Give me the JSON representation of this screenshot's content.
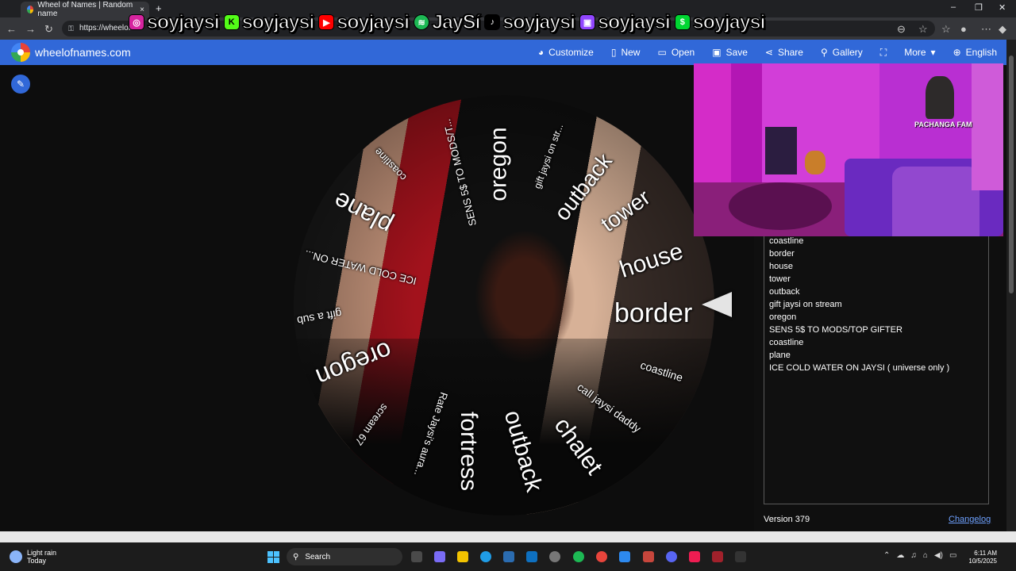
{
  "browser": {
    "tab_title": "Wheel of Names | Random name",
    "tab_close": "×",
    "new_tab": "+",
    "url": "https://wheelof",
    "win_min": "–",
    "win_max": "❐",
    "win_close": "✕"
  },
  "overlay": [
    {
      "platform": "instagram",
      "handle": "soyjaysi",
      "color": "#d6249f",
      "glyph": "◎"
    },
    {
      "platform": "kick",
      "handle": "soyjaysi",
      "color": "#53fc18",
      "glyph": "K"
    },
    {
      "platform": "youtube",
      "handle": "soyjaysi",
      "color": "#ff0000",
      "glyph": "▶"
    },
    {
      "platform": "spotify",
      "handle": "JaySí",
      "color": "#1db954",
      "glyph": "≋"
    },
    {
      "platform": "tiktok",
      "handle": "soyjaysi",
      "color": "#000000",
      "glyph": "♪"
    },
    {
      "platform": "twitch",
      "handle": "soyjaysi",
      "color": "#9146ff",
      "glyph": "▣"
    },
    {
      "platform": "cashapp",
      "handle": "soyjaysi",
      "color": "#00d632",
      "glyph": "$"
    }
  ],
  "header": {
    "site_name": "wheelofnames.com",
    "menu": [
      {
        "label": "Customize",
        "icon": "palette-icon",
        "glyph": "◕"
      },
      {
        "label": "New",
        "icon": "file-icon",
        "glyph": "▯"
      },
      {
        "label": "Open",
        "icon": "folder-icon",
        "glyph": "▭"
      },
      {
        "label": "Save",
        "icon": "save-icon",
        "glyph": "▣"
      },
      {
        "label": "Share",
        "icon": "share-icon",
        "glyph": "⋖"
      },
      {
        "label": "Gallery",
        "icon": "search-icon",
        "glyph": "⚲"
      },
      {
        "label": "",
        "icon": "fullscreen-icon",
        "glyph": "⛶"
      },
      {
        "label": "More",
        "icon": "chevron-down-icon",
        "glyph": "▾"
      },
      {
        "label": "English",
        "icon": "globe-icon",
        "glyph": "⊕"
      }
    ]
  },
  "wheel": {
    "segments": [
      "oregon",
      "gift jaysi on str...",
      "outback",
      "tower",
      "house",
      "border",
      "coastline",
      "call jaysi daddy",
      "chalet",
      "outback",
      "fortress",
      "Rate Jaysi's aura...",
      "scream 67",
      "oregon",
      "gift a sub",
      "ICE COLD WATER ON...",
      "plane",
      "coastline",
      "SENS 5$ TO MODS/T..."
    ]
  },
  "webcam": {
    "badge": "PACHANGA FAM"
  },
  "entries": [
    "coastline",
    "border",
    "house",
    "tower",
    "outback",
    "gift jaysi on stream",
    "oregon",
    "SENS 5$ TO MODS/TOP GIFTER",
    "coastline",
    "plane",
    "ICE COLD WATER ON JAYSI ( universe only )"
  ],
  "footer": {
    "version": "Version 379",
    "changelog": "Changelog"
  },
  "taskbar": {
    "weather_line1": "Light rain",
    "weather_line2": "Today",
    "search": "Search",
    "time": "6:11 AM",
    "date": "10/5/2025"
  }
}
